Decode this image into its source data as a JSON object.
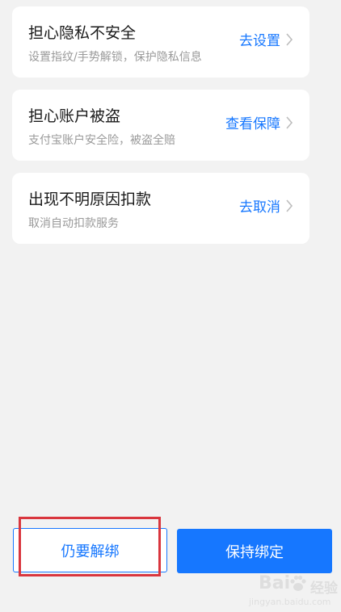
{
  "cards": [
    {
      "title": "担心隐私不安全",
      "subtitle": "设置指纹/手势解锁，保护隐私信息",
      "action": "去设置"
    },
    {
      "title": "担心账户被盗",
      "subtitle": "支付宝账户安全险，被盗全赔",
      "action": "查看保障"
    },
    {
      "title": "出现不明原因扣款",
      "subtitle": "取消自动扣款服务",
      "action": "去取消"
    }
  ],
  "buttons": {
    "unbind_label": "仍要解绑",
    "keep_label": "保持绑定"
  },
  "watermark": {
    "brand_prefix": "Bai",
    "brand_suffix": "经验",
    "url": "jingyan.baidu.com"
  },
  "colors": {
    "accent": "#1677ff",
    "highlight": "#d9363e",
    "background": "#f2f2f2"
  },
  "icons": {
    "chevron": "chevron-right-icon",
    "watermark_logo": "baidu-paw-icon"
  }
}
